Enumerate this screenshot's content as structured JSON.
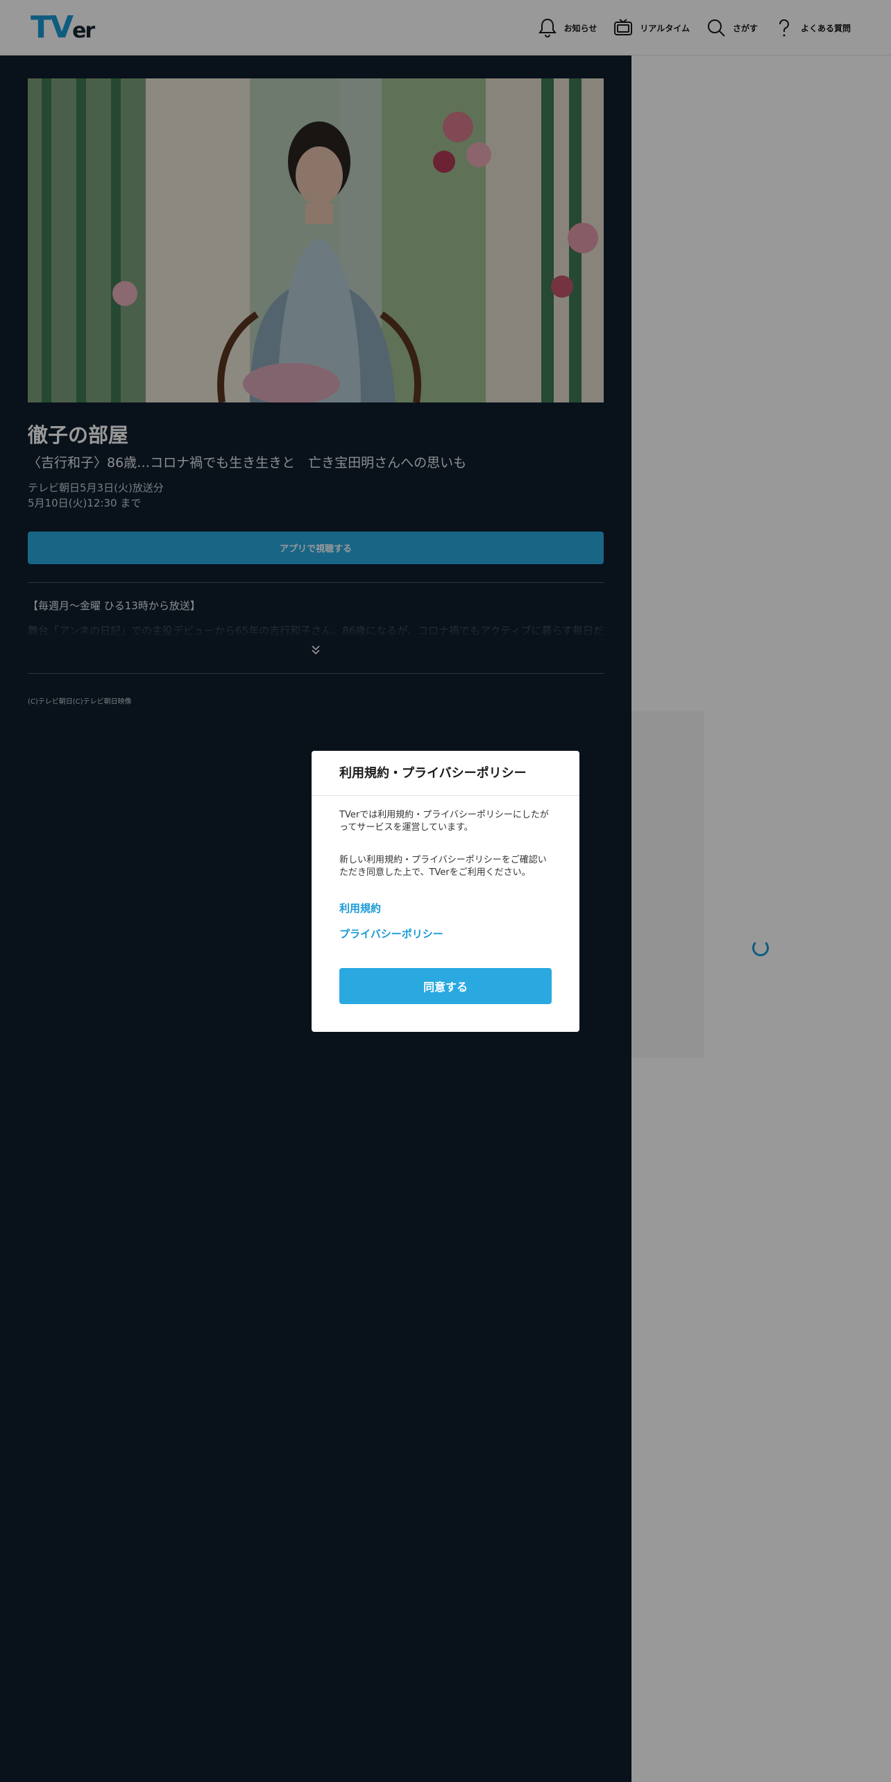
{
  "header": {
    "logo": {
      "t": "T",
      "v": "V",
      "er": "er"
    },
    "nav": [
      {
        "label": "お知らせ",
        "icon": "bell-icon"
      },
      {
        "label": "リアルタイム",
        "icon": "tv-icon"
      },
      {
        "label": "さがす",
        "icon": "search-icon"
      },
      {
        "label": "よくある質問",
        "icon": "question-icon"
      }
    ]
  },
  "episode": {
    "title": "徹子の部屋",
    "subtitle": "〈吉行和子〉86歳…コロナ禍でも生き生きと　亡き宝田明さんへの思いも",
    "broadcast": "テレビ朝日5月3日(火)放送分",
    "expires": "5月10日(火)12:30 まで",
    "watch_button": "アプリで視聴する",
    "description_heading": "【毎週月～金曜 ひる13時から放送】",
    "description_preview": "舞台「アンネの日記」での主役デビューから65年の吉行和子さん。86歳になるが、コロナ禍でもアクティブに暮らす毎日だ",
    "copyright": "(C)テレビ朝日(C)テレビ朝日映像"
  },
  "modal": {
    "title": "利用規約・プライバシーポリシー",
    "paragraph1": "TVerでは利用規約・プライバシーポリシーにしたがってサービスを運営しています。",
    "paragraph2": "新しい利用規約・プライバシーポリシーをご確認いただき同意した上で、TVerをご利用ください。",
    "terms_link": "利用規約",
    "privacy_link": "プライバシーポリシー",
    "agree_button": "同意する"
  },
  "colors": {
    "brand": "#1a9ad6",
    "dark_bg": "#0f1d2d",
    "button": "#29a9e0"
  }
}
